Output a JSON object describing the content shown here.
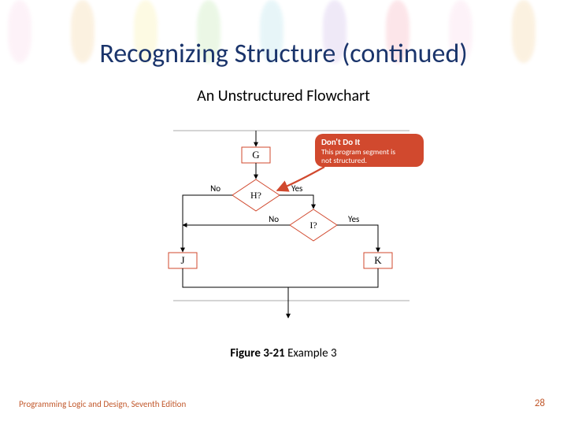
{
  "title": "Recognizing Structure (continued)",
  "subtitle": "An Unstructured Flowchart",
  "caption_bold": "Figure 3-21",
  "caption_rest": " Example 3",
  "footer_left": "Programming Logic and Design, Seventh Edition",
  "page_number": "28",
  "flowchart": {
    "nodes": {
      "G": "G",
      "H": "H?",
      "I": "I?",
      "J": "J",
      "K": "K"
    },
    "labels": {
      "yes": "Yes",
      "no": "No"
    },
    "callout": {
      "head": "Don't Do It",
      "body1": "This program segment is",
      "body2": "not structured."
    }
  }
}
